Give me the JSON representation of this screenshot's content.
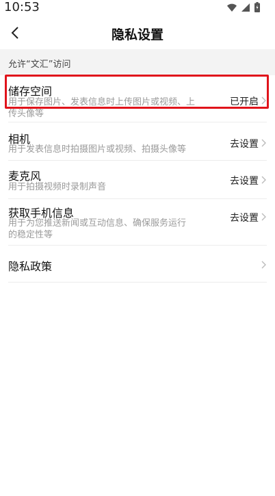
{
  "status_bar": {
    "time": "10:53",
    "icons": [
      "wifi-icon",
      "signal-icon",
      "battery-icon"
    ]
  },
  "nav": {
    "title": "隐私设置",
    "back_icon": "chevron-left-icon"
  },
  "section": {
    "label": "允许“文汇”访问"
  },
  "items": [
    {
      "title": "储存空间",
      "desc": "用于保存图片、发表信息时上传图片或视频、上传头像等",
      "value": "已开启"
    },
    {
      "title": "相机",
      "desc": "用于发表信息时拍摄图片或视频、拍摄头像等",
      "value": "去设置"
    },
    {
      "title": "麦克风",
      "desc": "用于拍摄视频时录制声音",
      "value": "去设置"
    },
    {
      "title": "获取手机信息",
      "desc": "用于为您推送新闻或互动信息、确保服务运行的稳定性等",
      "value": "去设置"
    },
    {
      "title": "隐私政策"
    }
  ],
  "colors": {
    "highlight": "#e0131b",
    "section_bg": "#f3f3f3",
    "muted": "#9a9a9a"
  }
}
